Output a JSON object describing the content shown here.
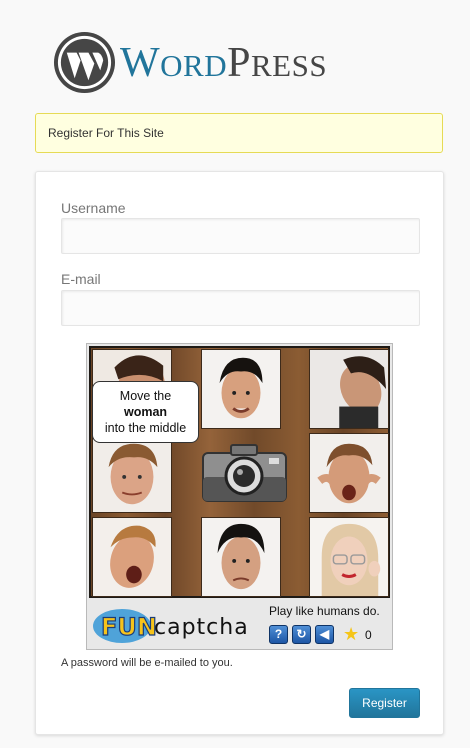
{
  "brand": {
    "name_part1": "WORD",
    "name_part2": "PRESS"
  },
  "message": "Register For This Site",
  "form": {
    "username_label": "Username",
    "username_value": "",
    "email_label": "E-mail",
    "email_value": "",
    "password_note": "A password will be e-mailed to you.",
    "register_label": "Register"
  },
  "captcha": {
    "instruction_line1": "Move the",
    "instruction_bold": "woman",
    "instruction_line3": "into the middle",
    "tagline": "Play like humans do.",
    "logo_text_fun": "FUN",
    "logo_text_captcha": "captcha",
    "buttons": [
      "help-icon",
      "refresh-icon",
      "audio-icon"
    ],
    "score": "0"
  },
  "colors": {
    "accent": "#21759b",
    "message_bg": "#ffffe0",
    "message_border": "#e6db55"
  }
}
